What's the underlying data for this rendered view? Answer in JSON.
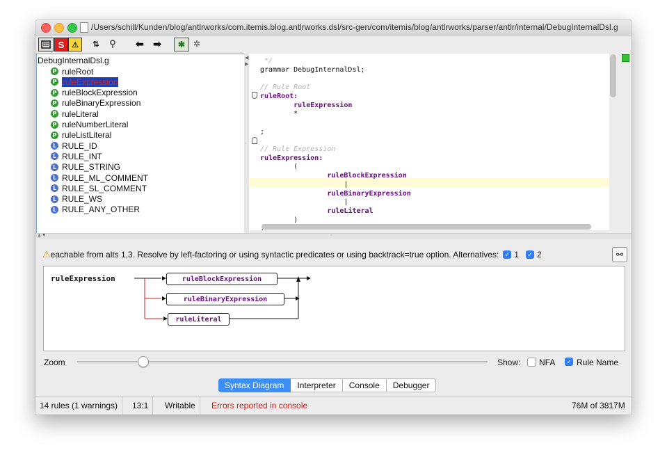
{
  "window": {
    "title": "/Users/schill/Kunden/blog/antlrworks/com.itemis.blog.antlrworks.dsl/src-gen/com/itemis/blog/antlrworks/parser/antlr/internal/DebugInternalDsl.g"
  },
  "toolbar": {
    "save_icon": "save-icon",
    "s_label": "S",
    "warn_label": "⚠",
    "sort_icon": "sort-icon",
    "find_icon": "find-icon",
    "back_label": "⬅",
    "forward_label": "➡",
    "debug_icon": "debug-icon",
    "bug_icon": "bug-icon"
  },
  "tree": {
    "root": "DebugInternalDsl.g",
    "items": [
      {
        "label": "ruleRoot",
        "icon": "P",
        "selected": false
      },
      {
        "label": "ruleExpression",
        "icon": "P",
        "selected": true
      },
      {
        "label": "ruleBlockExpression",
        "icon": "P",
        "selected": false
      },
      {
        "label": "ruleBinaryExpression",
        "icon": "P",
        "selected": false
      },
      {
        "label": "ruleLiteral",
        "icon": "P",
        "selected": false
      },
      {
        "label": "ruleNumberLiteral",
        "icon": "P",
        "selected": false
      },
      {
        "label": "ruleListLiteral",
        "icon": "P",
        "selected": false
      },
      {
        "label": "RULE_ID",
        "icon": "L",
        "selected": false
      },
      {
        "label": "RULE_INT",
        "icon": "L",
        "selected": false
      },
      {
        "label": "RULE_STRING",
        "icon": "L",
        "selected": false
      },
      {
        "label": "RULE_ML_COMMENT",
        "icon": "L",
        "selected": false
      },
      {
        "label": "RULE_SL_COMMENT",
        "icon": "L",
        "selected": false
      },
      {
        "label": "RULE_WS",
        "icon": "L",
        "selected": false
      },
      {
        "label": "RULE_ANY_OTHER",
        "icon": "L",
        "selected": false
      }
    ]
  },
  "editor": {
    "lines": [
      {
        "text": " */",
        "style": "cm"
      },
      {
        "text": "grammar DebugInternalDsl;",
        "style": ""
      },
      {
        "text": "",
        "style": ""
      },
      {
        "text": "// Rule Root",
        "style": "cm"
      },
      {
        "text": "ruleRoot:",
        "style": "kw"
      },
      {
        "text": "        ruleExpression",
        "style": "kw"
      },
      {
        "text": "        *",
        "style": ""
      },
      {
        "text": "",
        "style": ""
      },
      {
        "text": ";",
        "style": ""
      },
      {
        "text": "",
        "style": ""
      },
      {
        "text": "// Rule Expression",
        "style": "cm"
      },
      {
        "text": "ruleExpression:",
        "style": "kw"
      },
      {
        "text": "        (",
        "style": ""
      },
      {
        "text": "                ruleBlockExpression",
        "style": "kw"
      },
      {
        "text": "                    |",
        "style": ""
      },
      {
        "text": "                ruleBinaryExpression",
        "style": "kw"
      },
      {
        "text": "                    |",
        "style": ""
      },
      {
        "text": "                ruleLiteral",
        "style": "kw"
      },
      {
        "text": "        )",
        "style": ""
      },
      {
        "text": ";",
        "style": ""
      }
    ]
  },
  "warning": {
    "text": "eachable from alts 1,3.  Resolve by left-factoring or using syntactic predicates or using backtrack=true option. Alternatives:",
    "alt1": "1",
    "alt2": "2"
  },
  "diagram": {
    "rule_name": "ruleExpression",
    "alternatives": [
      "ruleBlockExpression",
      "ruleBinaryExpression",
      "ruleLiteral"
    ]
  },
  "zoom": {
    "label": "Zoom",
    "level": 0.16,
    "show_label": "Show:",
    "nfa_label": "NFA",
    "nfa_checked": false,
    "rulename_label": "Rule Name",
    "rulename_checked": true
  },
  "tabs": [
    "Syntax Diagram",
    "Interpreter",
    "Console",
    "Debugger"
  ],
  "status": {
    "rules": "14 rules (1 warnings)",
    "position": "13:1",
    "mode": "Writable",
    "errors": "Errors reported in console",
    "memory": "76M of 3817M"
  },
  "colors": {
    "error_red": "#d61f1f",
    "keyword_purple": "#6a0d80",
    "accent_blue": "#3b8ff5"
  }
}
